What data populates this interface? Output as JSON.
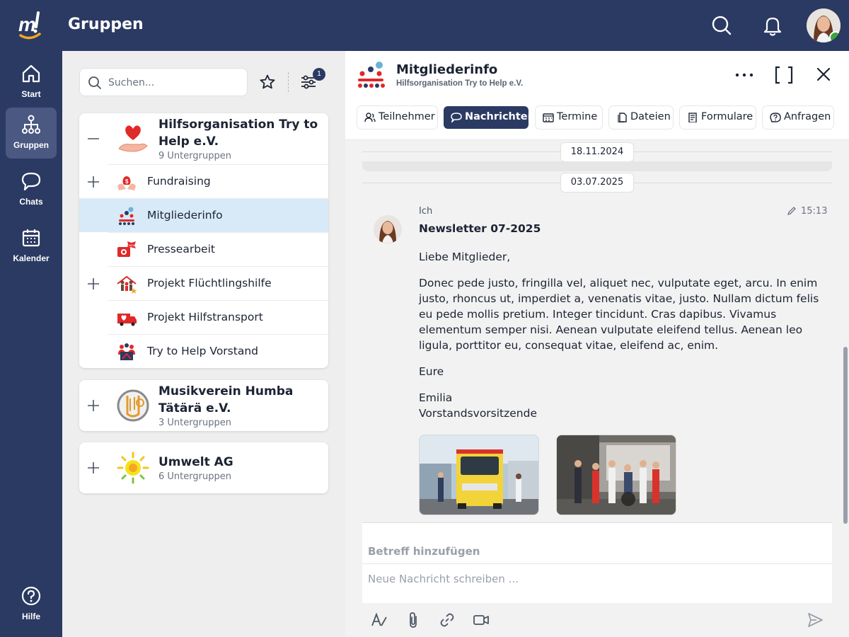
{
  "app": {
    "page_title": "Gruppen",
    "brand_color": "#2b3a63",
    "accent_color": "#f5a623"
  },
  "topbar": {
    "icons": [
      "search-icon",
      "bell-icon"
    ],
    "avatar_status": "online"
  },
  "rail": {
    "items": [
      {
        "label": "Start",
        "icon": "home-icon"
      },
      {
        "label": "Gruppen",
        "icon": "hierarchy-icon",
        "active": true
      },
      {
        "label": "Chats",
        "icon": "chat-bubble-icon"
      },
      {
        "label": "Kalender",
        "icon": "calendar-icon"
      }
    ],
    "help_label": "Hilfe"
  },
  "groups_panel": {
    "search_placeholder": "Suchen...",
    "filter_count": "1",
    "groups": [
      {
        "name": "Hilfsorganisation Try to Help e.V.",
        "subcount": "9 Untergruppen",
        "expanded": true,
        "subgroups": [
          {
            "name": "Fundraising",
            "expandable": true
          },
          {
            "name": "Mitgliederinfo",
            "active": true
          },
          {
            "name": "Pressearbeit"
          },
          {
            "name": "Projekt Flüchtlingshilfe",
            "expandable": true
          },
          {
            "name": "Projekt Hilfstransport"
          },
          {
            "name": "Try to Help Vorstand"
          }
        ]
      },
      {
        "name": "Musikverein Humba Tätärä e.V.",
        "subcount": "3 Untergruppen",
        "expanded": false
      },
      {
        "name": "Umwelt AG",
        "subcount": "6 Untergruppen",
        "expanded": false
      }
    ]
  },
  "detail": {
    "title": "Mitgliederinfo",
    "subtitle": "Hilfsorganisation Try to Help e.V.",
    "tabs": [
      {
        "label": "Teilnehmer",
        "icon": "people-icon"
      },
      {
        "label": "Nachrichten",
        "icon": "chat-icon",
        "active": true
      },
      {
        "label": "Termine",
        "icon": "calendar-icon"
      },
      {
        "label": "Dateien",
        "icon": "files-icon"
      },
      {
        "label": "Formulare",
        "icon": "form-icon"
      },
      {
        "label": "Anfragen",
        "icon": "question-icon"
      }
    ],
    "dates": [
      "18.11.2024",
      "03.07.2025"
    ],
    "message": {
      "author": "Ich",
      "time": "15:13",
      "subject": "Newsletter 07-2025",
      "greeting": "Liebe Mitglieder,",
      "body": "Donec pede justo, fringilla vel, aliquet nec, vulputate eget, arcu. In enim justo, rhoncus ut, imperdiet a, venenatis vitae, justo. Nullam dictum felis eu pede mollis pretium. Integer tincidunt. Cras dapibus. Vivamus elementum semper nisi. Aenean vulputate eleifend tellus. Aenean leo ligula, porttitor eu, consequat vitae, eleifend ac, enim.",
      "closing": "Eure",
      "signature_name": "Emilia",
      "signature_role": "Vorstandsvorsitzende",
      "attachments": [
        "ambulance-photo",
        "volunteers-photo"
      ]
    },
    "composer": {
      "subject_placeholder": "Betreff hinzufügen",
      "message_placeholder": "Neue Nachricht schreiben ..."
    }
  }
}
